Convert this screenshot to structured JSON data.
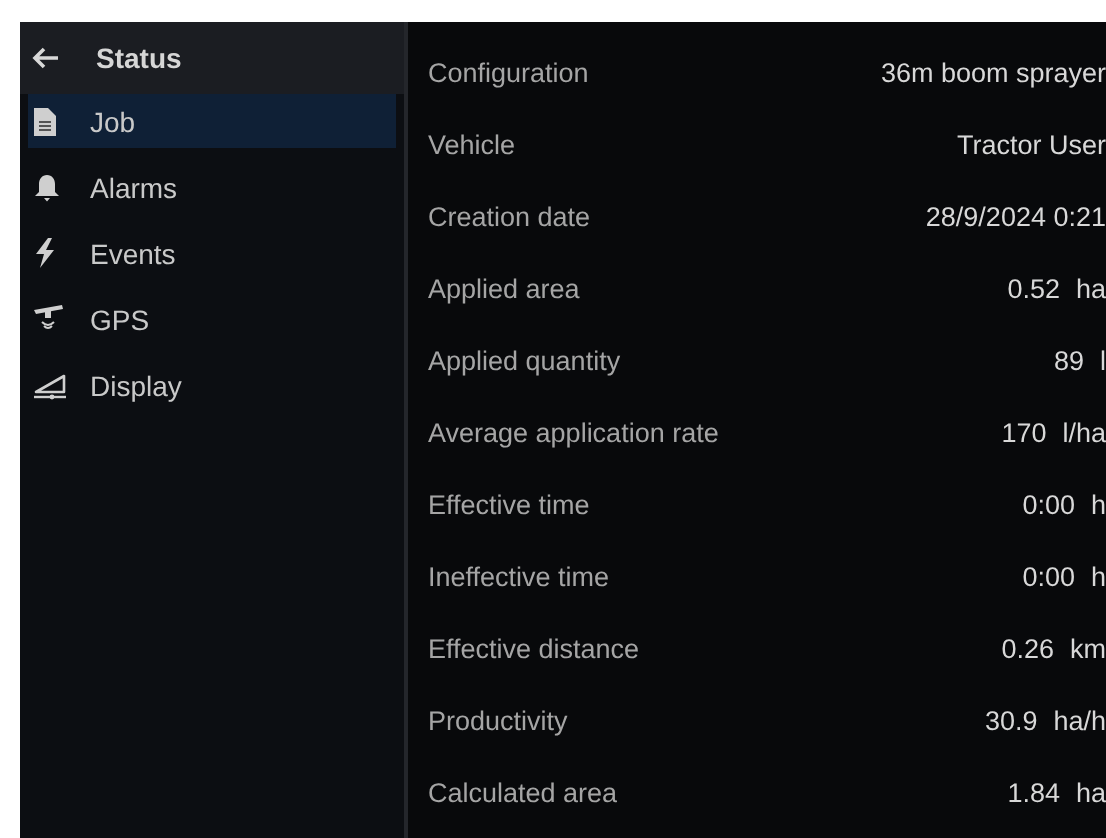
{
  "sidebar": {
    "title": "Status",
    "items": [
      {
        "label": "Job",
        "selected": true
      },
      {
        "label": "Alarms",
        "selected": false
      },
      {
        "label": "Events",
        "selected": false
      },
      {
        "label": "GPS",
        "selected": false
      },
      {
        "label": "Display",
        "selected": false
      }
    ]
  },
  "details": [
    {
      "label": "Configuration",
      "value": "36m boom sprayer"
    },
    {
      "label": "Vehicle",
      "value": "Tractor User"
    },
    {
      "label": "Creation date",
      "value": "28/9/2024 0:21"
    },
    {
      "label": "Applied area",
      "value": "0.52",
      "unit": "ha"
    },
    {
      "label": "Applied quantity",
      "value": "89",
      "unit": "l"
    },
    {
      "label": "Average application rate",
      "value": "170",
      "unit": "l/ha"
    },
    {
      "label": "Effective time",
      "value": "0:00",
      "unit": "h"
    },
    {
      "label": "Ineffective time",
      "value": "0:00",
      "unit": "h"
    },
    {
      "label": "Effective distance",
      "value": "0.26",
      "unit": "km"
    },
    {
      "label": "Productivity",
      "value": "30.9",
      "unit": "ha/h"
    },
    {
      "label": "Calculated area",
      "value": "1.84",
      "unit": "ha"
    }
  ]
}
